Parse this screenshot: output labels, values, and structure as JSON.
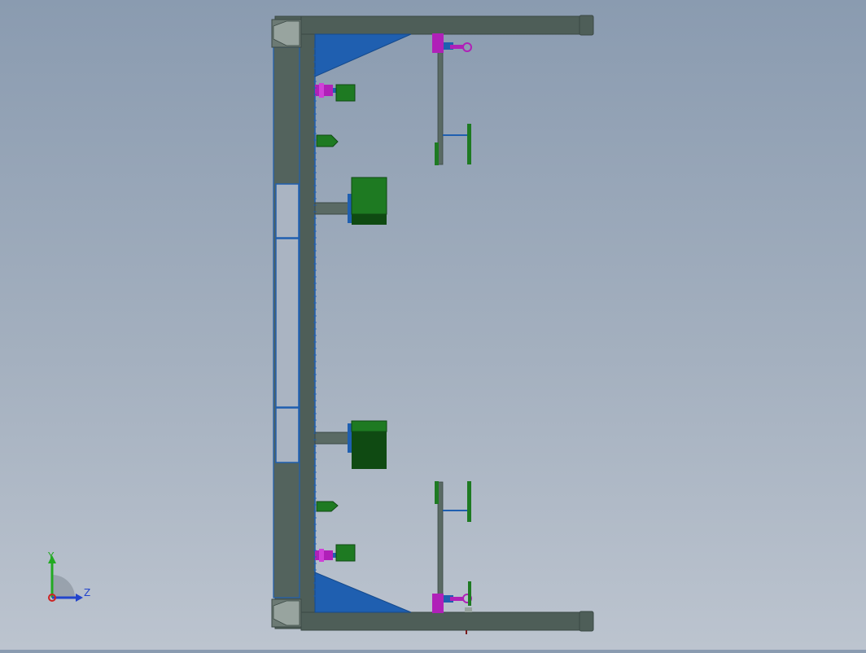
{
  "view": {
    "name": "cad-side-view-fixture-frame"
  },
  "colors": {
    "background_top": "#8a9bb0",
    "background_bottom": "#bcc4cf",
    "frame": "#4e5e58",
    "frame_edge": "#3a4844",
    "blue": "#1f5fb0",
    "green": "#1e7a22",
    "dark_green": "#0f4a12",
    "magenta": "#b020b8",
    "dark_red": "#7a1a1a"
  },
  "triad": {
    "y_label": "Y",
    "z_label": "Z",
    "y_color": "#22aa22",
    "z_color": "#2244cc",
    "x_color": "#cc2222"
  }
}
